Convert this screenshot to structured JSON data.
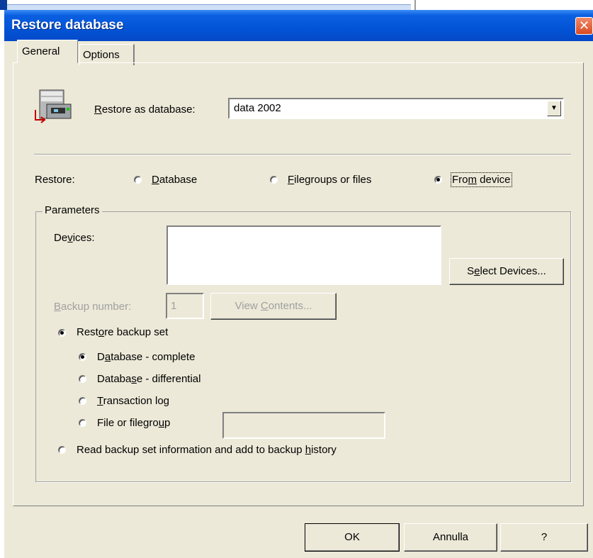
{
  "window": {
    "title": "Restore database",
    "close_label": "✕"
  },
  "tabs": [
    {
      "label": "General"
    },
    {
      "label": "Options"
    }
  ],
  "restore_as": {
    "label_hot": "R",
    "label_rest": "estore as database:",
    "value": "data 2002"
  },
  "restore": {
    "label": "Restore:",
    "options": [
      {
        "hot": "D",
        "rest": "atabase",
        "selected": false
      },
      {
        "hot": "F",
        "rest": "ilegroups or files",
        "selected": false
      },
      {
        "pre": "Fro",
        "hot": "m",
        "rest": " device",
        "selected": true
      }
    ]
  },
  "parameters": {
    "legend": "Parameters",
    "devices_label_pre": "De",
    "devices_label_hot": "v",
    "devices_label_rest": "ices:",
    "select_devices_pre": "S",
    "select_devices_hot": "e",
    "select_devices_rest": "lect Devices...",
    "backup_number_hot": "B",
    "backup_number_rest": "ackup number:",
    "backup_number_value": "1",
    "view_contents_pre": "View ",
    "view_contents_hot": "C",
    "view_contents_rest": "ontents...",
    "restore_backup_set": {
      "pre": "Rest",
      "hot": "o",
      "rest": "re backup set",
      "selected": true
    },
    "backup_types": [
      {
        "pre": "D",
        "hot": "a",
        "rest": "tabase - complete",
        "selected": true
      },
      {
        "pre": "Databa",
        "hot": "s",
        "rest": "e - differential",
        "selected": false
      },
      {
        "pre": "",
        "hot": "T",
        "rest": "ransaction log",
        "selected": false
      },
      {
        "pre": "File or filegro",
        "hot": "u",
        "rest": "p",
        "selected": false
      }
    ],
    "read_backup_info": {
      "pre": "Read backup set information and add to backup ",
      "hot": "h",
      "rest": "istory",
      "selected": false
    }
  },
  "buttons": {
    "ok": "OK",
    "cancel": "Annulla",
    "help": "?"
  },
  "colors": {
    "titlebar": "#0254d6",
    "dialog_bg": "#ece9d8",
    "close_button": "#d84a20"
  },
  "icons": {
    "db_icon": "database-server-icon",
    "close_icon": "close-icon",
    "dropdown_icon": "chevron-down-icon"
  }
}
